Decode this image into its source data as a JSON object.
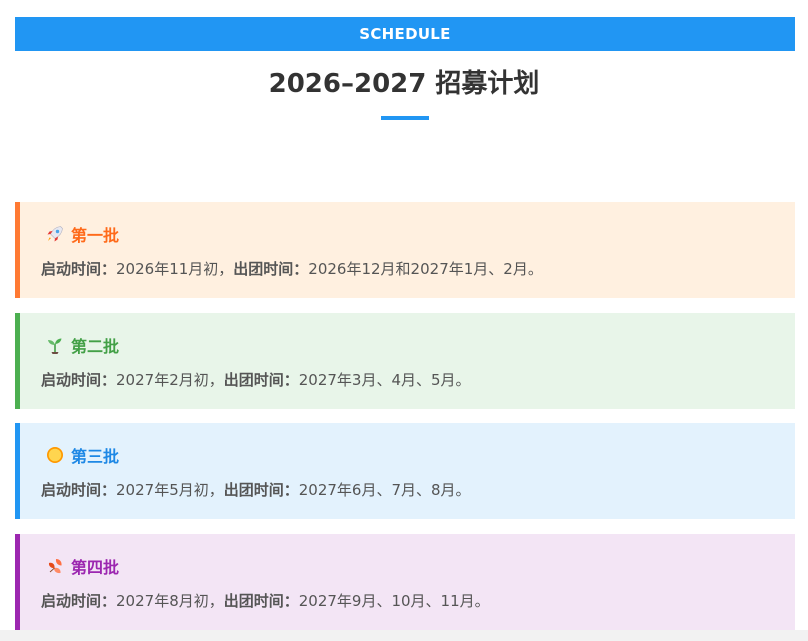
{
  "header": {
    "banner_label": "SCHEDULE",
    "title": "2026–2027 招募计划",
    "accent_color": "#2196f3"
  },
  "batches": [
    {
      "icon": "rocket-icon",
      "title": "第一批",
      "start_label": "启动时间：",
      "start_value": "2026年11月初，",
      "depart_label": "出团时间：",
      "depart_value": "2026年12月和2027年1月、2月。",
      "color": "#ff7a33"
    },
    {
      "icon": "seedling-icon",
      "title": "第二批",
      "start_label": "启动时间：",
      "start_value": "2027年2月初，",
      "depart_label": "出团时间：",
      "depart_value": "2027年3月、4月、5月。",
      "color": "#4caf50"
    },
    {
      "icon": "sun-icon",
      "title": "第三批",
      "start_label": "启动时间：",
      "start_value": "2027年5月初，",
      "depart_label": "出团时间：",
      "depart_value": "2027年6月、7月、8月。",
      "color": "#2196f3"
    },
    {
      "icon": "falling-leaves-icon",
      "title": "第四批",
      "start_label": "启动时间：",
      "start_value": "2027年8月初，",
      "depart_label": "出团时间：",
      "depart_value": "2027年9月、10月、11月。",
      "color": "#9c27b0"
    }
  ]
}
